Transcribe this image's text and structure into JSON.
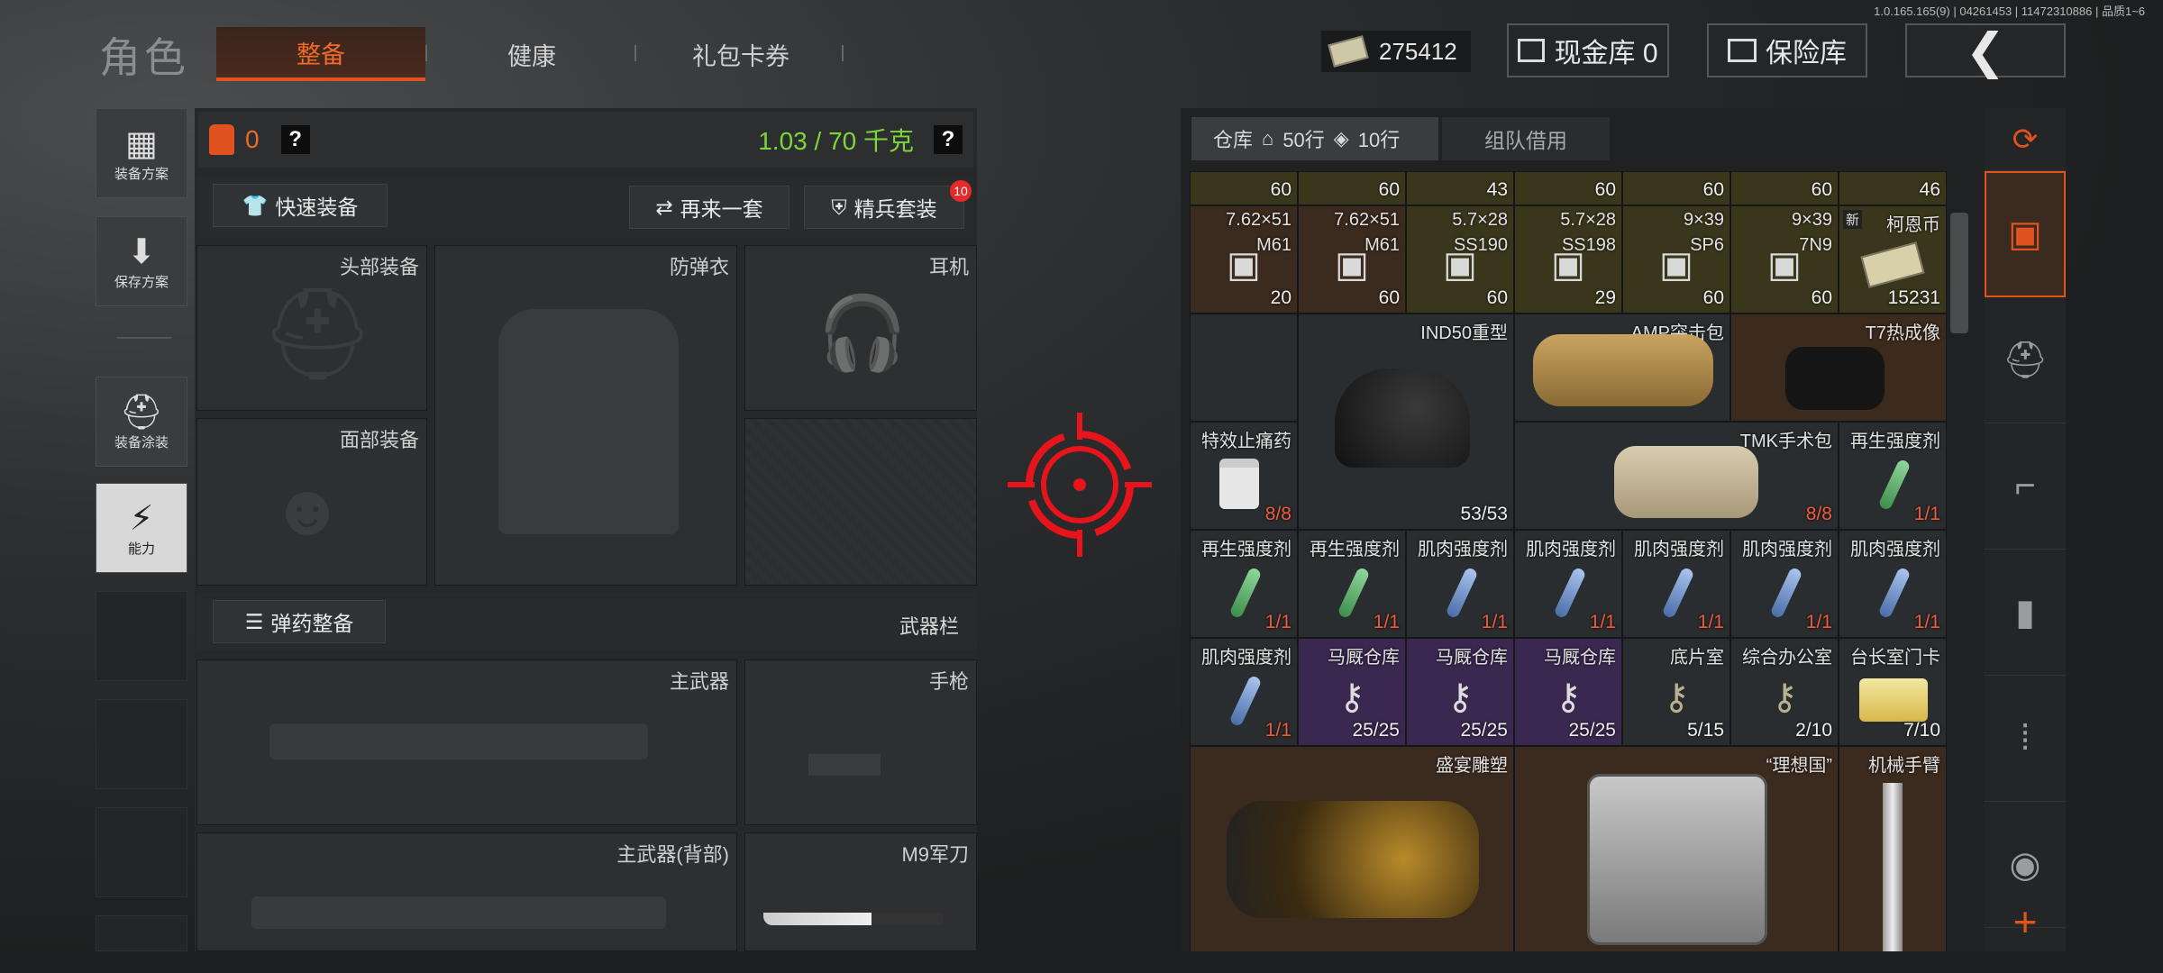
{
  "version": "1.0.165.165(9) | 04261453 | 11472310886 | 品质1~6",
  "header": {
    "title": "角色",
    "tabs": [
      {
        "label": "整备",
        "active": true
      },
      {
        "label": "健康"
      },
      {
        "label": "礼包卡券"
      }
    ],
    "money": "275412",
    "cash_vault": "现金库 0",
    "safe_vault": "保险库"
  },
  "sidebar": [
    {
      "label": "装备方案",
      "icon": "vest-icon"
    },
    {
      "label": "保存方案",
      "icon": "download-icon"
    },
    {
      "label": "装备涂装",
      "icon": "helmet-icon"
    },
    {
      "label": "能力",
      "icon": "ability-icon"
    }
  ],
  "loadout": {
    "vest_count": "0",
    "weight": "1.03 / 70 千克",
    "help": "?",
    "quick_equip": "快速装备",
    "redo_set": "再来一套",
    "elite_set": "精兵套装",
    "elite_badge": "10",
    "slots": {
      "head": "头部装备",
      "armor": "防弹衣",
      "headset": "耳机",
      "face": "面部装备",
      "ammo_btn": "弹药整备",
      "weapon_bar": "武器栏",
      "primary": "主武器",
      "pistol": "手枪",
      "primary_back": "主武器(背部)",
      "knife": "M9军刀"
    }
  },
  "warehouse": {
    "tab_label": "仓库",
    "rows1": "50行",
    "rows2": "10行",
    "team_tab": "组队借用",
    "top_counts": [
      "60",
      "60",
      "43",
      "60",
      "60",
      "60",
      "46"
    ],
    "ammo_row": [
      {
        "l1": "7.62×51",
        "l2": "M61",
        "cnt": "20"
      },
      {
        "l1": "7.62×51",
        "l2": "M61",
        "cnt": "60"
      },
      {
        "l1": "5.7×28",
        "l2": "SS190",
        "cnt": "60"
      },
      {
        "l1": "5.7×28",
        "l2": "SS198",
        "cnt": "29"
      },
      {
        "l1": "9×39",
        "l2": "SP6",
        "cnt": "60"
      },
      {
        "l1": "9×39",
        "l2": "7N9",
        "cnt": "60"
      },
      {
        "l1": "柯恩币",
        "l2": "新",
        "cnt": "15231"
      }
    ],
    "big_items": {
      "ind50": "IND50重型",
      "amp": "AMP突击包",
      "t7": "T7热成像",
      "painkiller": "特效止痛药",
      "painkiller_cnt": "8/8",
      "nvg_cnt": "53/53",
      "tmk": "TMK手术包",
      "tmk_cnt": "8/8"
    },
    "regen_label": "再生强度剂",
    "muscle_label": "肌肉强度剂",
    "stim_cnt": "1/1",
    "keys": [
      {
        "label": "马厩仓库",
        "cnt": "25/25"
      },
      {
        "label": "马厩仓库",
        "cnt": "25/25"
      },
      {
        "label": "马厩仓库",
        "cnt": "25/25"
      },
      {
        "label": "底片室",
        "cnt": "5/15"
      },
      {
        "label": "综合办公室",
        "cnt": "2/10"
      },
      {
        "label": "台长室门卡",
        "cnt": "7/10"
      }
    ],
    "bottom": {
      "feast": "盛宴雕塑",
      "ideal": "“理想国”",
      "arm": "机械手臂"
    }
  },
  "colors": {
    "accent": "#e0521e",
    "weight_green": "#7dd63a",
    "crosshair": "#e8141c"
  }
}
